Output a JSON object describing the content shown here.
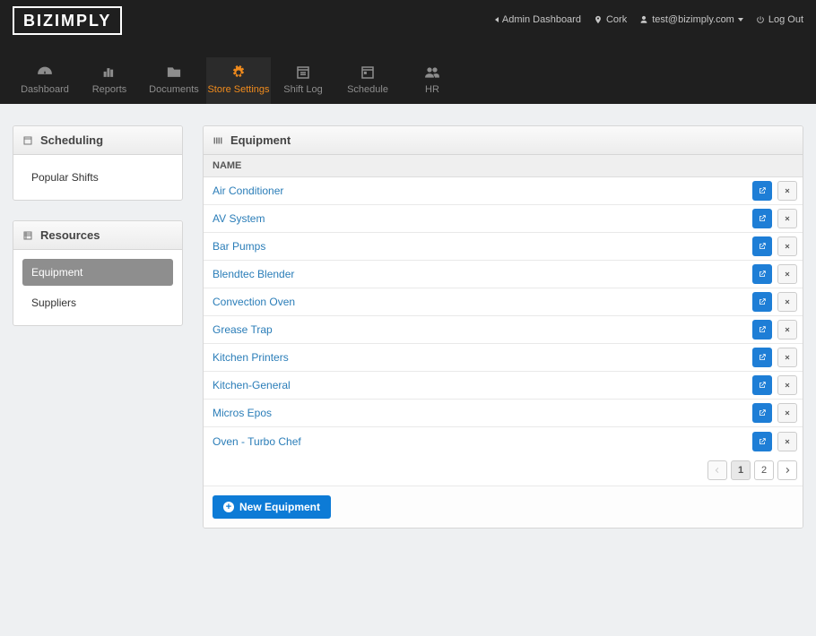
{
  "header": {
    "logo": "BIZIMPLY",
    "links": {
      "admin": "Admin Dashboard",
      "location": "Cork",
      "user": "test@bizimply.com",
      "logout": "Log Out"
    }
  },
  "nav": {
    "items": [
      {
        "label": "Dashboard",
        "icon": "gauge-icon"
      },
      {
        "label": "Reports",
        "icon": "chart-icon"
      },
      {
        "label": "Documents",
        "icon": "folder-icon"
      },
      {
        "label": "Store Settings",
        "icon": "cogs-icon"
      },
      {
        "label": "Shift Log",
        "icon": "calendar-lines-icon"
      },
      {
        "label": "Schedule",
        "icon": "calendar-icon"
      },
      {
        "label": "HR",
        "icon": "people-icon"
      }
    ],
    "active_index": 3
  },
  "sidebar": {
    "sections": [
      {
        "title": "Scheduling",
        "items": [
          {
            "label": "Popular Shifts"
          }
        ],
        "active_index": -1
      },
      {
        "title": "Resources",
        "items": [
          {
            "label": "Equipment"
          },
          {
            "label": "Suppliers"
          }
        ],
        "active_index": 0
      }
    ]
  },
  "main": {
    "title": "Equipment",
    "column_header": "NAME",
    "rows": [
      {
        "name": "Air Conditioner"
      },
      {
        "name": "AV System"
      },
      {
        "name": "Bar Pumps"
      },
      {
        "name": "Blendtec Blender"
      },
      {
        "name": "Convection Oven"
      },
      {
        "name": "Grease Trap"
      },
      {
        "name": "Kitchen Printers"
      },
      {
        "name": "Kitchen-General"
      },
      {
        "name": "Micros Epos"
      },
      {
        "name": "Oven - Turbo Chef"
      }
    ],
    "paging": {
      "pages": [
        "1",
        "2"
      ],
      "current": 0
    },
    "new_button": "New Equipment"
  }
}
